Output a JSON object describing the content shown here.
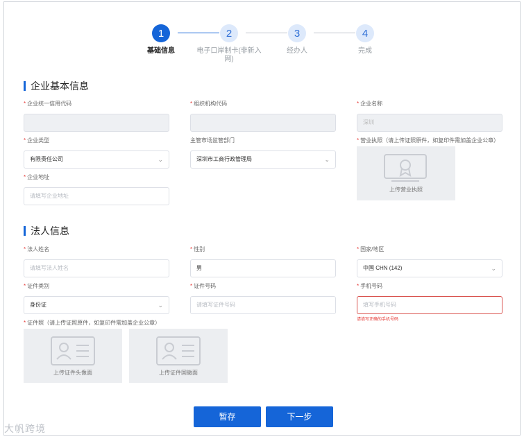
{
  "steps": [
    {
      "num": "1",
      "label": "基础信息"
    },
    {
      "num": "2",
      "label": "电子口岸制卡(非新入网)"
    },
    {
      "num": "3",
      "label": "经办人"
    },
    {
      "num": "4",
      "label": "完成"
    }
  ],
  "section_enterprise": {
    "title": "企业基本信息",
    "credit_code": {
      "label": "企业统一信用代码",
      "value": ""
    },
    "org_code": {
      "label": "组织机构代码",
      "value": ""
    },
    "name": {
      "label": "企业名称",
      "value": "深圳"
    },
    "type": {
      "label": "企业类型",
      "value": "有限责任公司"
    },
    "supervisor": {
      "label": "主管市场监管部门",
      "value": "深圳市工商行政管理局"
    },
    "license": {
      "label": "营业执照（请上传证照原件，如复印件需加盖企业公章）",
      "upload_caption": "上传营业执照"
    },
    "address": {
      "label": "企业地址",
      "placeholder": "请填写企业地址"
    }
  },
  "section_legal": {
    "title": "法人信息",
    "name": {
      "label": "法人姓名",
      "placeholder": "请填写法人姓名"
    },
    "gender": {
      "label": "性别",
      "value": "男"
    },
    "country": {
      "label": "国家/地区",
      "value": "中国 CHN (142)"
    },
    "id_type": {
      "label": "证件类别",
      "value": "身份证"
    },
    "id_number": {
      "label": "证件号码",
      "placeholder": "请填写证件号码"
    },
    "phone": {
      "label": "手机号码",
      "placeholder": "填写手机号码",
      "error": "请填写正确的手机号码"
    },
    "id_photo": {
      "label": "证件照（请上传证照原件，如复印件需加盖企业公章）",
      "front_caption": "上传证件头像面",
      "back_caption": "上传证件国徽面"
    }
  },
  "buttons": {
    "save": "暂存",
    "next": "下一步"
  },
  "watermark": "大帆跨境",
  "colors": {
    "primary": "#1565d8",
    "error": "#e53935"
  }
}
